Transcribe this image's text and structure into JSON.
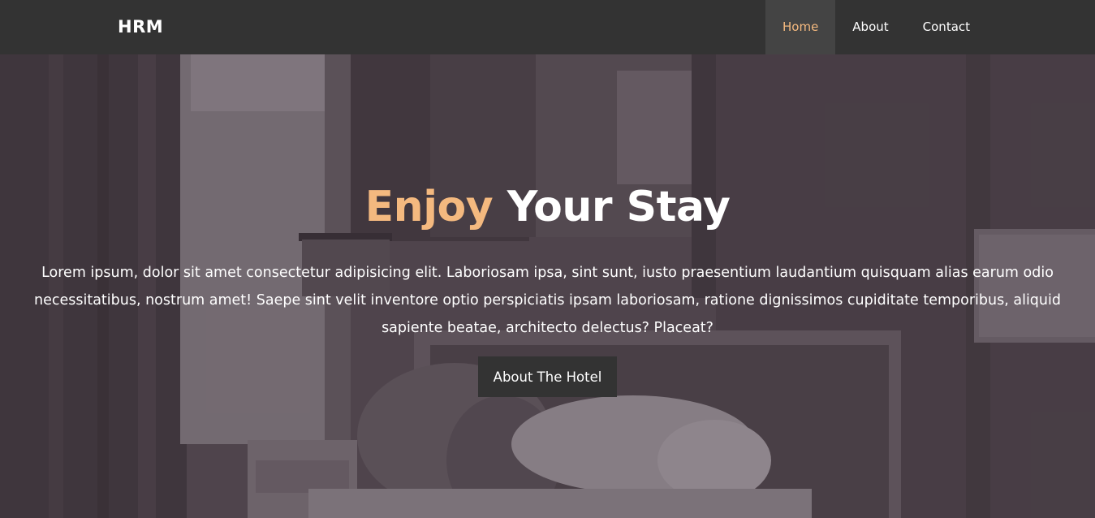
{
  "nav": {
    "brand": "HRM",
    "links": [
      {
        "label": "Home",
        "active": true
      },
      {
        "label": "About",
        "active": false
      },
      {
        "label": "Contact",
        "active": false
      }
    ]
  },
  "hero": {
    "title_accent": "Enjoy",
    "title_rest": "Your Stay",
    "text": "Lorem ipsum, dolor sit amet consectetur adipisicing elit. Laboriosam ipsa, sint sunt, iusto praesentium laudantium quisquam alias earum odio necessitatibus, nostrum amet! Saepe sint velit inventore optio perspiciatis ipsam laboriosam, ratione dignissimos cupiditate temporibus, aliquid sapiente beatae, architecto delectus? Placeat?",
    "button_label": "About The Hotel"
  },
  "colors": {
    "accent": "#f4b97f",
    "navbar": "#333333",
    "nav_active_bg": "#444444",
    "button_bg": "#333333"
  }
}
